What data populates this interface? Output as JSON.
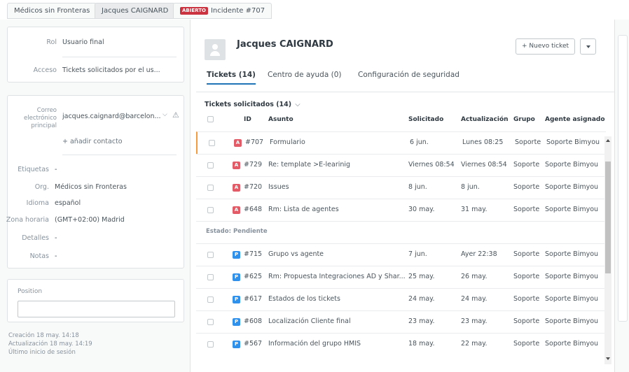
{
  "tabs": [
    {
      "label": "Médicos sin Fronteras"
    },
    {
      "label": "Jacques CAIGNARD"
    },
    {
      "badge": "ABIERTO",
      "label": "Incidente #707"
    }
  ],
  "left": {
    "card1": {
      "rol_label": "Rol",
      "rol_value": "Usuario final",
      "acceso_label": "Acceso",
      "acceso_value": "Tickets solicitados por el us..."
    },
    "card2": {
      "correo_label_1": "Correo",
      "correo_label_2": "electrónico",
      "correo_label_3": "principal",
      "correo_value": "jacques.caignard@barcelon...",
      "add_contact": "+ añadir contacto"
    },
    "fields": {
      "etiquetas_label": "Etiquetas",
      "etiquetas_value": "-",
      "org_label": "Org.",
      "org_value": "Médicos sin Fronteras",
      "idioma_label": "Idioma",
      "idioma_value": "español",
      "zona_label": "Zona horaria",
      "zona_value": "(GMT+02:00) Madrid",
      "detalles_label": "Detalles",
      "detalles_value": "-",
      "notas_label": "Notas",
      "notas_value": "-"
    },
    "position_label": "Position",
    "position_value": "",
    "creacion": "Creación 18 may. 14:18",
    "actualizacion": "Actualización 18 may. 14:19",
    "ultimo": "Último inicio de sesión"
  },
  "user": {
    "name": "Jacques CAIGNARD",
    "new_ticket": "+ Nuevo ticket",
    "tabs": [
      "Tickets (14)",
      "Centro de ayuda (0)",
      "Configuración de seguridad"
    ]
  },
  "tickets": {
    "section_title": "Tickets solicitados (14)",
    "headers": [
      "ID",
      "Asunto",
      "Solicitado",
      "Actualización",
      "Grupo",
      "Agente asignado"
    ],
    "pending_label": "Estado: Pendiente",
    "open": [
      {
        "status": "A",
        "id": "#707",
        "subject": "Formulario",
        "requested": "6 jun.",
        "updated": "Lunes 08:25",
        "group": "Soporte",
        "agent": "Soporte Bimyou"
      },
      {
        "status": "A",
        "id": "#729",
        "subject": "Re: template >E-learinig",
        "requested": "Viernes 08:54",
        "updated": "Viernes 08:54",
        "group": "Soporte",
        "agent": "Soporte Bimyou"
      },
      {
        "status": "A",
        "id": "#720",
        "subject": "Issues",
        "requested": "8 jun.",
        "updated": "8 jun.",
        "group": "Soporte",
        "agent": "Soporte Bimyou"
      },
      {
        "status": "A",
        "id": "#648",
        "subject": "Rm: Lista de agentes",
        "requested": "30 may.",
        "updated": "31 may.",
        "group": "Soporte",
        "agent": "Soporte Bimyou"
      }
    ],
    "pending": [
      {
        "status": "P",
        "id": "#715",
        "subject": "Grupo vs agente",
        "requested": "7 jun.",
        "updated": "Ayer 22:38",
        "group": "Soporte",
        "agent": "Soporte Bimyou"
      },
      {
        "status": "P",
        "id": "#625",
        "subject": "Rm: Propuesta Integraciones AD y Shar...",
        "requested": "25 may.",
        "updated": "26 may.",
        "group": "Soporte",
        "agent": "Soporte Bimyou"
      },
      {
        "status": "P",
        "id": "#617",
        "subject": "Estados de los tickets",
        "requested": "24 may.",
        "updated": "24 may.",
        "group": "Soporte",
        "agent": "Soporte Bimyou"
      },
      {
        "status": "P",
        "id": "#608",
        "subject": "Localización Cliente final",
        "requested": "23 may.",
        "updated": "23 may.",
        "group": "Soporte",
        "agent": "Soporte Bimyou"
      },
      {
        "status": "P",
        "id": "#567",
        "subject": "Información del grupo HMIS",
        "requested": "18 may.",
        "updated": "22 may.",
        "group": "Soporte",
        "agent": "Soporte Bimyou"
      }
    ]
  },
  "colors": {
    "open_status": "#e35b66",
    "pending_status": "#3091ec",
    "selected_row_accent": "#f79a3e",
    "badge": "#cc3340"
  }
}
